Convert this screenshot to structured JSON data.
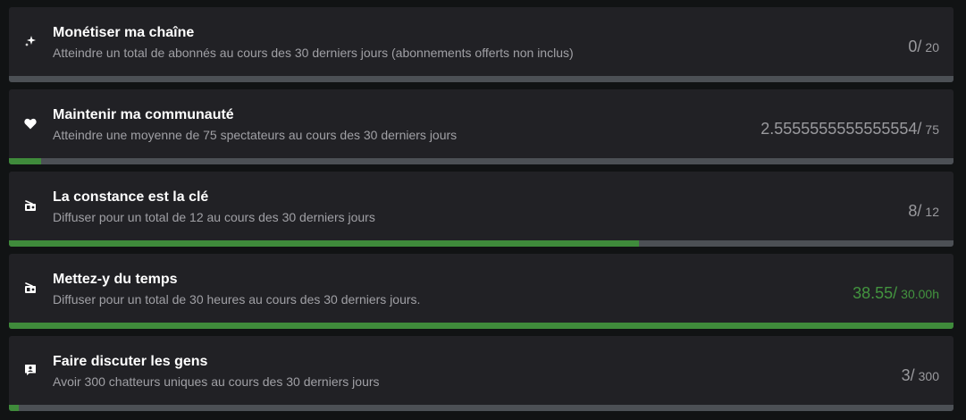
{
  "colors": {
    "background": "#111314",
    "card": "#212125",
    "track": "#4c5055",
    "fill": "#3f8b3b",
    "done_text": "#43943f"
  },
  "goals": [
    {
      "icon": "sparkle-icon",
      "title": "Monétiser ma chaîne",
      "description": "Atteindre un total de abonnés au cours des 30 derniers jours (abonnements offerts non inclus)",
      "current": "0/",
      "total": "20",
      "progress": 0
    },
    {
      "icon": "heart-icon",
      "title": "Maintenir ma communauté",
      "description": "Atteindre une moyenne de 75 spectateurs au cours des 30 derniers jours",
      "current": "2.5555555555555554/",
      "total": "75",
      "progress": 0.034
    },
    {
      "icon": "broadcast-icon",
      "title": "La constance est la clé",
      "description": "Diffuser pour un total de 12 au cours des 30 derniers jours",
      "current": "8/",
      "total": "12",
      "progress": 0.667
    },
    {
      "icon": "broadcast-icon",
      "title": "Mettez-y du temps",
      "description": "Diffuser pour un total de 30 heures au cours des 30 derniers jours.",
      "current": "38.55/",
      "total": "30.00h",
      "progress": 1,
      "complete": true
    },
    {
      "icon": "chat-icon",
      "title": "Faire discuter les gens",
      "description": "Avoir 300 chatteurs uniques au cours des 30 derniers jours",
      "current": "3/",
      "total": "300",
      "progress": 0.01
    }
  ]
}
